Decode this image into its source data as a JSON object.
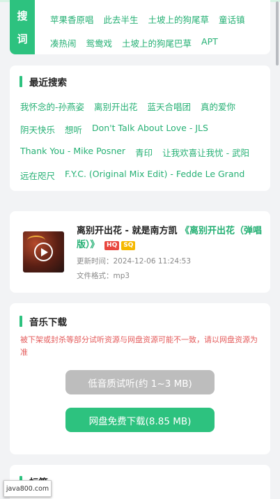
{
  "hot_words": {
    "tag": [
      "搜",
      "词"
    ],
    "row1": [
      "苹果香原唱",
      "此去半生",
      "土坡上的狗尾草",
      "童话镇"
    ],
    "row2": [
      "凑热闹",
      "鸳鸯戏",
      "土坡上的狗尾巴草",
      "APT"
    ]
  },
  "recent": {
    "title": "最近搜索",
    "row1": [
      "我怀念的-孙燕姿",
      "离别开出花",
      "蓝天合唱团",
      "真的爱你"
    ],
    "row2": [
      "阴天快乐",
      "想听",
      "Don't Talk About Love - JLS"
    ],
    "row3": [
      "Thank You - Mike Posner",
      "青印",
      "让我欢喜让我忧 - 武阳"
    ],
    "row4": [
      "远在咫尺",
      "F.Y.C. (Original Mix Edit) - Fedde Le Grand"
    ]
  },
  "song": {
    "title": "离别开出花 - 就是南方凯",
    "album": "《离别开出花（弹唱版）》",
    "badge_hq": "HQ",
    "badge_sq": "SQ",
    "updated": "更新时间：2024-12-06 11:24:53",
    "format": "文件格式：mp3"
  },
  "download": {
    "title": "音乐下载",
    "warning": "被下架或封杀等部分试听资源与网盘资源可能不一致，请以网盘资源为准",
    "low_quality_button": "低音质试听(约 1~3 MB)",
    "pan_button": "网盘免费下载(8.85 MB)"
  },
  "tags": {
    "title": "标签"
  },
  "watermark": "java800.com",
  "colors": {
    "accent": "#2dc27f",
    "link": "#25b074",
    "warning": "#e45b5b",
    "hq": "#e8473f",
    "sq": "#f5b800"
  }
}
